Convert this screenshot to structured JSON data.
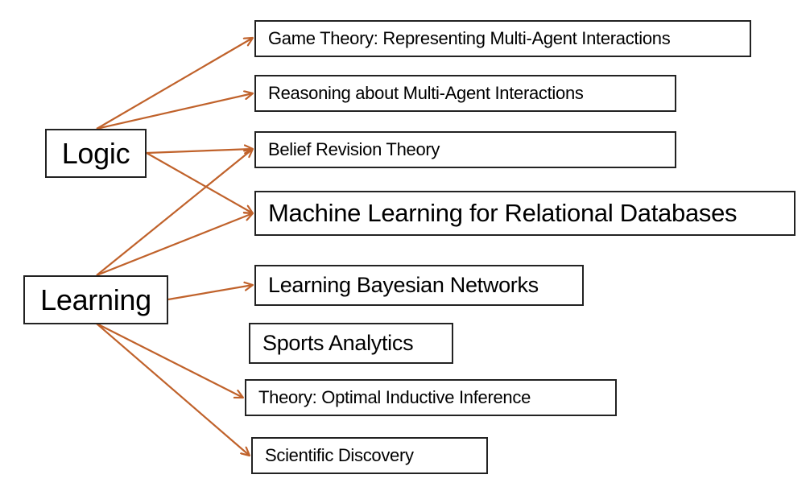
{
  "diagram": {
    "type": "concept-map",
    "arrow_color": "#c0622b",
    "border_color": "#222222",
    "sources": [
      {
        "id": "logic",
        "label": "Logic"
      },
      {
        "id": "learning",
        "label": "Learning"
      }
    ],
    "targets": [
      {
        "id": "game",
        "label": "Game Theory: Representing Multi-Agent Interactions"
      },
      {
        "id": "reason",
        "label": "Reasoning about Multi-Agent Interactions"
      },
      {
        "id": "belief",
        "label": "Belief Revision Theory"
      },
      {
        "id": "mlrdb",
        "label": "Machine Learning for Relational Databases"
      },
      {
        "id": "lbn",
        "label": "Learning Bayesian Networks"
      },
      {
        "id": "sports",
        "label": "Sports Analytics"
      },
      {
        "id": "theory",
        "label": "Theory: Optimal Inductive Inference"
      },
      {
        "id": "sci",
        "label": "Scientific Discovery"
      }
    ],
    "edges": [
      {
        "from": "logic",
        "to": "game"
      },
      {
        "from": "logic",
        "to": "reason"
      },
      {
        "from": "logic",
        "to": "belief"
      },
      {
        "from": "logic",
        "to": "mlrdb"
      },
      {
        "from": "learning",
        "to": "belief"
      },
      {
        "from": "learning",
        "to": "mlrdb"
      },
      {
        "from": "learning",
        "to": "lbn"
      },
      {
        "from": "learning",
        "to": "theory"
      },
      {
        "from": "learning",
        "to": "sci"
      }
    ]
  }
}
